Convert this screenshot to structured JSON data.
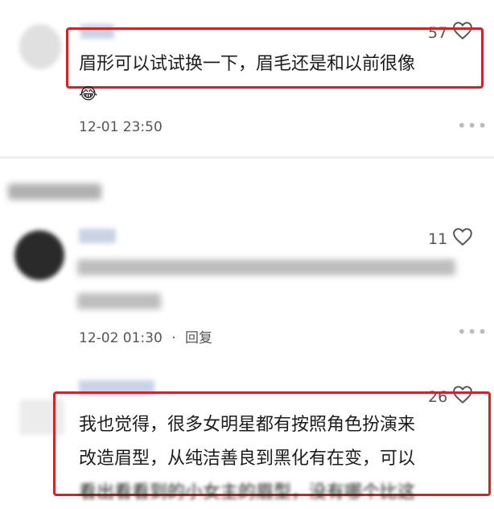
{
  "comments": [
    {
      "likes": "57",
      "text": "眉形可以试试换一下，眉毛还是和以前很像",
      "emoji": "😂",
      "time": "12-01 23:50",
      "more": "•••"
    },
    {
      "likes": "11",
      "time": "12-02 01:30",
      "separator": "·",
      "reply": "回复",
      "more": "•••"
    },
    {
      "likes": "26",
      "text_line1": "我也觉得，很多女明星都有按照角色扮演来",
      "text_line2": "改造眉型，从纯洁善良到黑化有在变，可以",
      "text_line3": "看出看看到的小女主的眉型，没有哪个比这"
    }
  ],
  "colors": {
    "highlight_border": "#d92027",
    "divider": "#f0f0f0"
  },
  "icons": [
    "heart-outline-icon",
    "more-dots-icon"
  ]
}
